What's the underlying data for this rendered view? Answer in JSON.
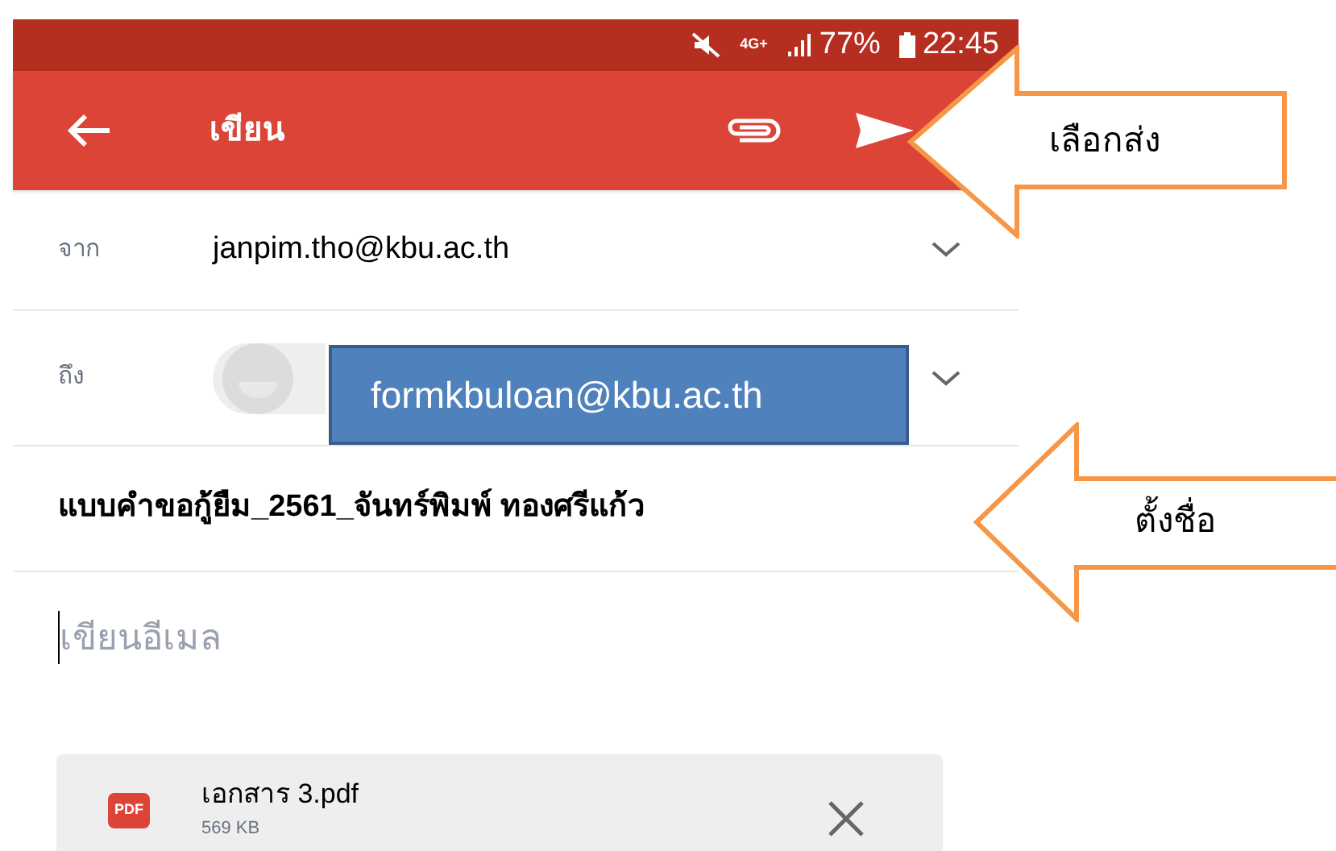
{
  "status_bar": {
    "network": "4G+",
    "battery": "77%",
    "time": "22:45"
  },
  "toolbar": {
    "title": "เขียน"
  },
  "from": {
    "label": "จาก",
    "value": "janpim.tho@kbu.ac.th"
  },
  "to": {
    "label": "ถึง",
    "recipient_overlay": "formkbuloan@kbu.ac.th"
  },
  "subject": {
    "value": "แบบคำขอกู้ยืม_2561_จันทร์พิมพ์ ทองศรีแก้ว"
  },
  "body": {
    "placeholder": "เขียนอีเมล"
  },
  "attachment": {
    "type": "PDF",
    "name": "เอกสาร 3.pdf",
    "size": "569 KB"
  },
  "callouts": [
    {
      "text": "เลือกส่ง"
    },
    {
      "text": "ตั้งชื่อ"
    }
  ]
}
